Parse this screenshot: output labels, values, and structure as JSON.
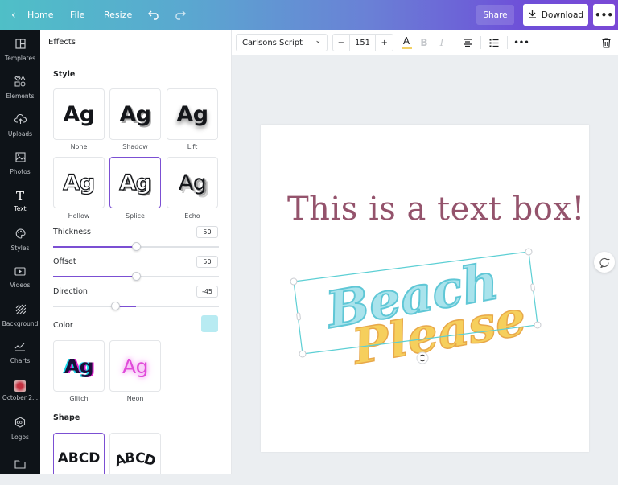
{
  "topbar": {
    "back_icon": "chevron-left-icon",
    "home_label": "Home",
    "file_label": "File",
    "resize_label": "Resize",
    "undo_icon": "undo-icon",
    "redo_icon": "redo-icon",
    "share_label": "Share",
    "download_label": "Download",
    "more_icon": "more-icon"
  },
  "sidebar": {
    "items": [
      {
        "label": "Templates",
        "icon": "templates-icon",
        "glyph": "◫"
      },
      {
        "label": "Elements",
        "icon": "elements-icon",
        "glyph": "♡△"
      },
      {
        "label": "Uploads",
        "icon": "upload-cloud-icon",
        "glyph": "☁"
      },
      {
        "label": "Photos",
        "icon": "photos-icon",
        "glyph": "▨"
      },
      {
        "label": "Text",
        "icon": "text-icon",
        "glyph": "T",
        "active": true
      },
      {
        "label": "Styles",
        "icon": "palette-icon",
        "glyph": "◕"
      },
      {
        "label": "Videos",
        "icon": "video-icon",
        "glyph": "▶"
      },
      {
        "label": "Background",
        "icon": "background-icon",
        "glyph": "▧"
      },
      {
        "label": "Charts",
        "icon": "charts-icon",
        "glyph": "〰"
      },
      {
        "label": "October 2...",
        "icon": "folder-thumbnail-icon",
        "glyph": ""
      },
      {
        "label": "Logos",
        "icon": "logos-icon",
        "glyph": "⬡"
      },
      {
        "label": "",
        "icon": "folder-icon",
        "glyph": "▭"
      }
    ]
  },
  "panel": {
    "title": "Effects",
    "style_title": "Style",
    "styles": [
      {
        "label": "None",
        "sample": "Ag",
        "selected": false
      },
      {
        "label": "Shadow",
        "sample": "Ag",
        "selected": false
      },
      {
        "label": "Lift",
        "sample": "Ag",
        "selected": false
      },
      {
        "label": "Hollow",
        "sample": "Ag",
        "selected": false
      },
      {
        "label": "Splice",
        "sample": "Ag",
        "selected": true
      },
      {
        "label": "Echo",
        "sample": "Ag",
        "selected": false
      },
      {
        "label": "Glitch",
        "sample": "Ag",
        "selected": false
      },
      {
        "label": "Neon",
        "sample": "Ag",
        "selected": false
      }
    ],
    "controls": {
      "thickness": {
        "label": "Thickness",
        "value": "50",
        "fraction": 0.5
      },
      "offset": {
        "label": "Offset",
        "value": "50",
        "fraction": 0.5
      },
      "direction": {
        "label": "Direction",
        "value": "-45",
        "min": -180,
        "max": 180
      },
      "color": {
        "label": "Color",
        "value": "#b8ebf2"
      }
    },
    "shape_title": "Shape",
    "shapes": [
      {
        "label": "ABCD",
        "type": "none",
        "selected": true
      },
      {
        "label": "ABCD",
        "type": "curve",
        "selected": false
      }
    ]
  },
  "text_toolbar": {
    "font": "Carlsons Script",
    "font_size": "151",
    "minus": "−",
    "plus": "+",
    "text_color_icon": "text-color-icon",
    "text_color": "#f2d166",
    "bold_icon": "bold-icon",
    "italic_icon": "italic-icon",
    "align_icon": "align-center-icon",
    "list_icon": "list-icon",
    "more_icon": "more-icon",
    "delete_icon": "trash-icon"
  },
  "canvas": {
    "headline": "This is a text box!",
    "headline_color": "#94536c",
    "art_line1": "Beach",
    "art_line2": "Please",
    "art_line1_color": "#a9e3ec",
    "art_line2_color": "#f6cf5c",
    "selection_color": "#5ccfd4"
  }
}
